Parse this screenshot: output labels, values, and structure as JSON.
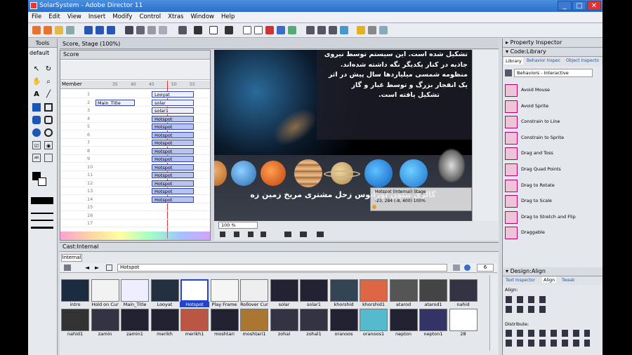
{
  "title": "SolarSystem - Adobe Director 11",
  "window_buttons": [
    "_",
    "□",
    "✕"
  ],
  "menu": [
    "File",
    "Edit",
    "View",
    "Insert",
    "Modify",
    "Control",
    "Xtras",
    "Window",
    "Help"
  ],
  "tools": {
    "title": "Tools",
    "mode": "default"
  },
  "score": {
    "tab": "Score, Stage (100%)",
    "title": "Score",
    "member_col": "Member",
    "frames": [
      "35",
      "40",
      "45",
      "50",
      "55"
    ],
    "rows": [
      "1",
      "2",
      "3",
      "4",
      "5",
      "6",
      "7",
      "8",
      "9",
      "10",
      "11",
      "12",
      "13",
      "14",
      "15",
      "16",
      "17"
    ],
    "sprites": [
      {
        "label": "",
        "right": "Looyat"
      },
      {
        "label": "Main_Title",
        "right": "solar"
      },
      {
        "label": "",
        "right": "solar1"
      },
      {
        "label": "",
        "right": "Hotspot"
      },
      {
        "label": "",
        "right": "Hotspot"
      },
      {
        "label": "",
        "right": "Hotspot"
      },
      {
        "label": "",
        "right": "Hotspot"
      },
      {
        "label": "",
        "right": "Hotspot"
      },
      {
        "label": "",
        "right": "Hotspot"
      },
      {
        "label": "",
        "right": "Hotspot"
      },
      {
        "label": "",
        "right": "Hotspot"
      },
      {
        "label": "",
        "right": "Hotspot"
      },
      {
        "label": "",
        "right": "Hotspot"
      },
      {
        "label": "",
        "right": "Hotspot"
      }
    ]
  },
  "stage": {
    "text": [
      "تشکیل شده است. این سیستم توسط نیروی",
      "جاذبه در کنار یکدیگر نگه داشته شده‌اند.",
      "منظومه شمسی میلیاردها سال پیش در اثر",
      "یک انفجار بزرگ و توسط غبار و گاز",
      "تشکیل یافته است."
    ],
    "planet_labels": "گالری  نپتون  اورانوس  زحل  مشتری  مریخ  زمین  زه",
    "tooltip": "Hotspot (Internal) Stage",
    "tooltip_sub": "-23, 284  (-8, 400) 100%",
    "zoom": "100 %"
  },
  "cast": {
    "title": "Cast:Internal",
    "tab": "Internal",
    "member_name": "Hotspot",
    "number": "6",
    "row1": [
      "intro",
      "Hold on Cur",
      "Main_Title",
      "Looyat",
      "Hotspot",
      "Play Frame",
      "Rollover Cur",
      "solar",
      "solar1",
      "khorshid",
      "khorshid1",
      "atarod",
      "atarod1",
      "nahid"
    ],
    "row2": [
      "nahid1",
      "zamin",
      "zamin1",
      "merikh",
      "merikh1",
      "moshtari",
      "moshtari1",
      "zohal",
      "zohal1",
      "oranoos",
      "oranoos1",
      "nepton",
      "nepton1",
      "28"
    ]
  },
  "right": {
    "property_inspector": "Property Inspector",
    "code_library": "Code:Library",
    "lib_tabs": [
      "Library",
      "Behavior Inspec",
      "Object Inspecto"
    ],
    "category": "Behaviors - Interactive",
    "behaviors": [
      "Avoid Mouse",
      "Avoid Sprite",
      "Constrain to Line",
      "Constrain to Sprite",
      "Drag and Toss",
      "Drag Quad Points",
      "Drag to Rotate",
      "Drag to Scale",
      "Drag to Stretch and Flip",
      "Draggable"
    ],
    "design_align": "Design:Align",
    "align_tabs": [
      "Text Inspector",
      "Align",
      "Tweak"
    ],
    "align_label": "Align:",
    "distribute_label": "Distribute:"
  }
}
